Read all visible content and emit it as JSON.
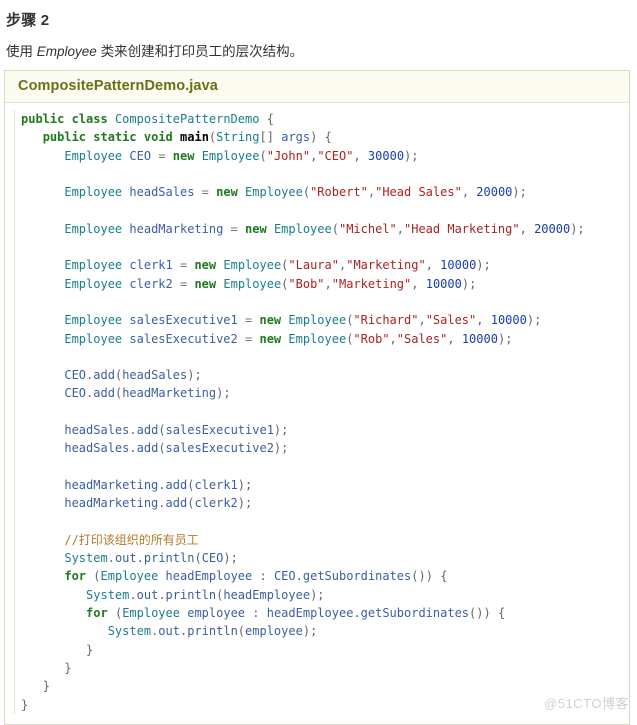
{
  "page": {
    "step_title": "步骤 2",
    "description_prefix": "使用 ",
    "description_italic": "Employee",
    "description_suffix": " 类来创建和打印员工的层次结构。"
  },
  "code_block": {
    "filename": "CompositePatternDemo.java",
    "language": "java",
    "lines": [
      "public class CompositePatternDemo {",
      "   public static void main(String[] args) {",
      "      Employee CEO = new Employee(\"John\",\"CEO\", 30000);",
      "",
      "      Employee headSales = new Employee(\"Robert\",\"Head Sales\", 20000);",
      "",
      "      Employee headMarketing = new Employee(\"Michel\",\"Head Marketing\", 20000);",
      "",
      "      Employee clerk1 = new Employee(\"Laura\",\"Marketing\", 10000);",
      "      Employee clerk2 = new Employee(\"Bob\",\"Marketing\", 10000);",
      "",
      "      Employee salesExecutive1 = new Employee(\"Richard\",\"Sales\", 10000);",
      "      Employee salesExecutive2 = new Employee(\"Rob\",\"Sales\", 10000);",
      "",
      "      CEO.add(headSales);",
      "      CEO.add(headMarketing);",
      "",
      "      headSales.add(salesExecutive1);",
      "      headSales.add(salesExecutive2);",
      "",
      "      headMarketing.add(clerk1);",
      "      headMarketing.add(clerk2);",
      "",
      "      //打印该组织的所有员工",
      "      System.out.println(CEO);",
      "      for (Employee headEmployee : CEO.getSubordinates()) {",
      "         System.out.println(headEmployee);",
      "         for (Employee employee : headEmployee.getSubordinates()) {",
      "            System.out.println(employee);",
      "         }",
      "      }",
      "   }",
      "}"
    ]
  },
  "watermark": {
    "text": "@51CTO博客"
  },
  "colors": {
    "keyword": "#1f7a1f",
    "type": "#1a7d8c",
    "string": "#aa2222",
    "number": "#1a3ea8",
    "comment": "#b07a2a",
    "identifier": "#3a5fa0",
    "header_title": "#6b7016",
    "panel_border": "#d8d8c0",
    "header_bg": "#fbfbef"
  }
}
